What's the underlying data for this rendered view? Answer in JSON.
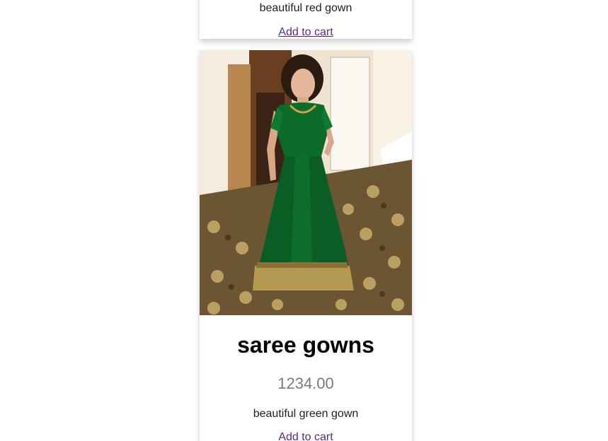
{
  "products": [
    {
      "description": "beautiful red gown",
      "cart_label": "Add to cart"
    },
    {
      "title": "saree gowns",
      "price": "1234.00",
      "description": "beautiful green gown",
      "cart_label": "Add to cart",
      "image_icon": "product-photo-green-gown"
    }
  ],
  "colors": {
    "link": "#5b2a86",
    "price": "#7a7a7a",
    "gown": "#0b6b2a"
  }
}
